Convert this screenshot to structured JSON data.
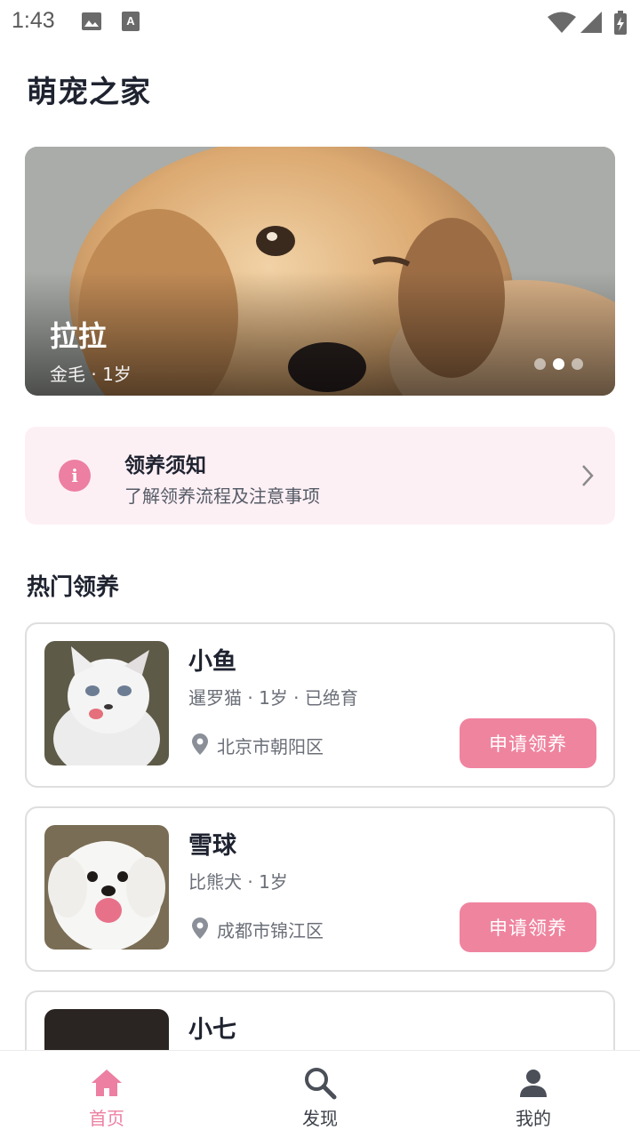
{
  "status_bar": {
    "time": "1:43"
  },
  "app": {
    "title": "萌宠之家"
  },
  "banner": {
    "name": "拉拉",
    "subtitle": "金毛 · 1岁",
    "page_count": 3,
    "active_index": 1
  },
  "notice": {
    "icon": "info-icon",
    "title": "领养须知",
    "subtitle": "了解领养流程及注意事项"
  },
  "section": {
    "title": "热门领养"
  },
  "pets": [
    {
      "name": "小鱼",
      "meta": "暹罗猫 · 1岁 · 已绝育",
      "location": "北京市朝阳区",
      "button": "申请领养"
    },
    {
      "name": "雪球",
      "meta": "比熊犬 · 1岁",
      "location": "成都市锦江区",
      "button": "申请领养"
    },
    {
      "name": "小七"
    }
  ],
  "tabbar": {
    "items": [
      {
        "label": "首页",
        "icon": "home-icon",
        "active": true
      },
      {
        "label": "发现",
        "icon": "search-icon",
        "active": false
      },
      {
        "label": "我的",
        "icon": "profile-icon",
        "active": false
      }
    ]
  },
  "colors": {
    "accent": "#ef849f",
    "notice_bg": "#fdf0f5",
    "text": "#1f2330"
  }
}
